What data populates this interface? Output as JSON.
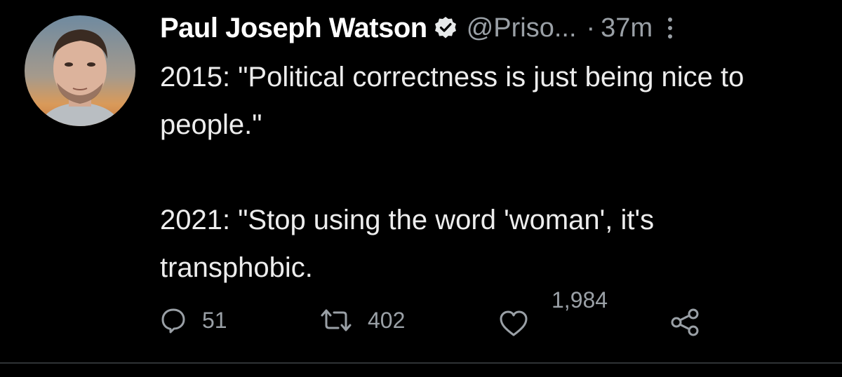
{
  "tweet": {
    "display_name": "Paul Joseph Watson",
    "handle": "@Priso...",
    "separator": "·",
    "time": "37m",
    "body": {
      "line1": "2015: \"Political correctness is just being nice to people.\"",
      "line2": "2021: \"Stop using the word 'woman', it's transphobic."
    },
    "stats": {
      "replies": "51",
      "retweets": "402",
      "likes": "1,984"
    }
  },
  "icons": {
    "verified": "verified-badge-icon",
    "more": "more-vertical-icon",
    "reply": "reply-bubble-icon",
    "retweet": "retweet-icon",
    "like": "heart-icon",
    "share": "share-icon"
  },
  "colors": {
    "background": "#000000",
    "text": "#e7e9ea",
    "muted": "#9aa0a6",
    "divider": "#2f3336"
  }
}
